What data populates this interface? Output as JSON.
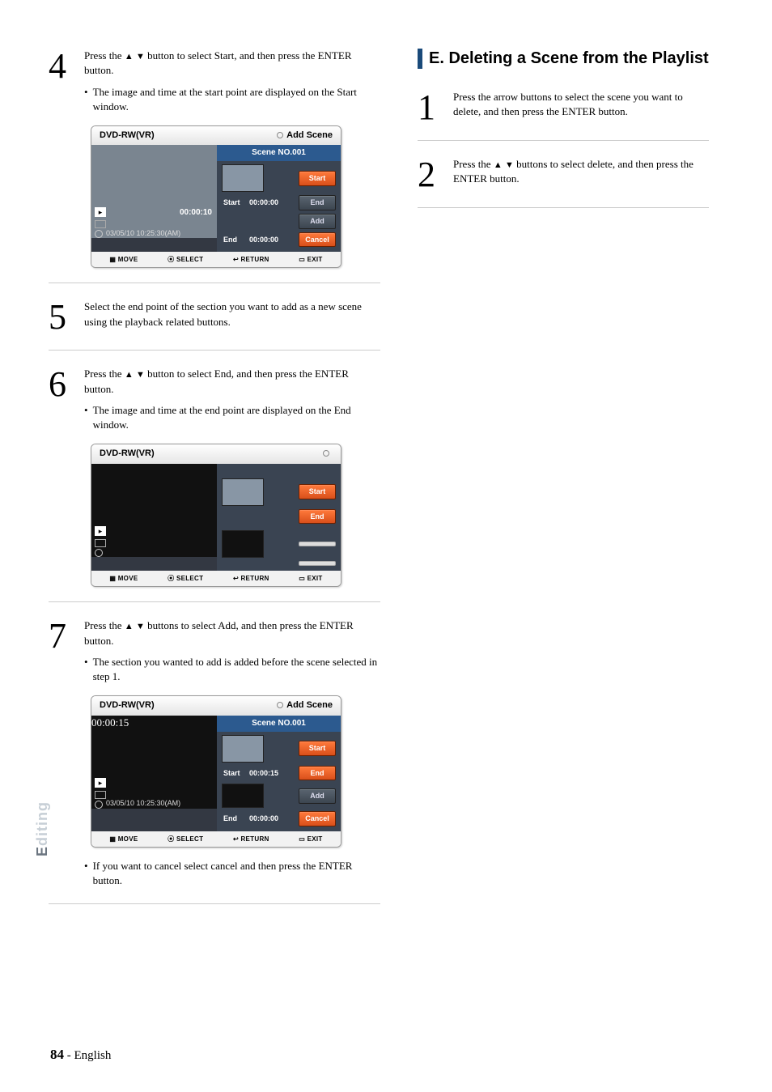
{
  "left": {
    "step4": {
      "num": "4",
      "text1_a": "Press the ",
      "text1_b": " button to select Start, and then press the ENTER button.",
      "bullet": "The image and time at the start point are displayed on the Start window."
    },
    "step5": {
      "num": "5",
      "text": "Select the end point of the section you want to add as a new scene using the playback related buttons."
    },
    "step6": {
      "num": "6",
      "text1_a": "Press the ",
      "text1_b": " button to select End, and then press the ENTER button.",
      "bullet": "The image and time at the end point are displayed on the End window."
    },
    "step7": {
      "num": "7",
      "text1_a": "Press the ",
      "text1_b": " buttons to select Add, and then press the ENTER button.",
      "bullet": "The section you wanted to add is added before the scene selected in step 1.",
      "bullet2": "If you want to cancel select cancel and then press the ENTER button."
    },
    "ss1": {
      "header_left": "DVD-RW(VR)",
      "header_right": "Add Scene",
      "scene_no": "Scene NO.001",
      "start_label": "Start",
      "end_label": "End",
      "start_time": "00:00:00",
      "end_time": "00:00:00",
      "preview_time": "00:00:10",
      "date": "03/05/10 10:25:30(AM)",
      "btn_start": "Start",
      "btn_end": "End",
      "btn_add": "Add",
      "btn_cancel": "Cancel"
    },
    "ss2": {
      "header_left": "DVD-RW(VR)",
      "btn_start": "Start",
      "btn_end": "End"
    },
    "ss3": {
      "header_left": "DVD-RW(VR)",
      "header_right": "Add Scene",
      "scene_no": "Scene NO.001",
      "start_label": "Start",
      "end_label": "End",
      "start_time": "00:00:15",
      "end_time": "00:00:00",
      "preview_time": "00:00:15",
      "date": "03/05/10 10:25:30(AM)",
      "btn_start": "Start",
      "btn_end": "End",
      "btn_add": "Add",
      "btn_cancel": "Cancel"
    },
    "ss_footer": {
      "move": "MOVE",
      "select": "SELECT",
      "return": "RETURN",
      "exit": "EXIT"
    }
  },
  "right": {
    "section_title": "E. Deleting a Scene from the Playlist",
    "step1": {
      "num": "1",
      "text": "Press the arrow buttons to select the scene you want to delete, and then press the ENTER button."
    },
    "step2": {
      "num": "2",
      "text1_a": "Press the ",
      "text1_b": " buttons to select delete, and then press the ENTER button."
    }
  },
  "sidebar": {
    "label_first": "E",
    "label_rest": "diting"
  },
  "footer": {
    "pagenum": "84",
    "dash": " - ",
    "lang": "English"
  }
}
